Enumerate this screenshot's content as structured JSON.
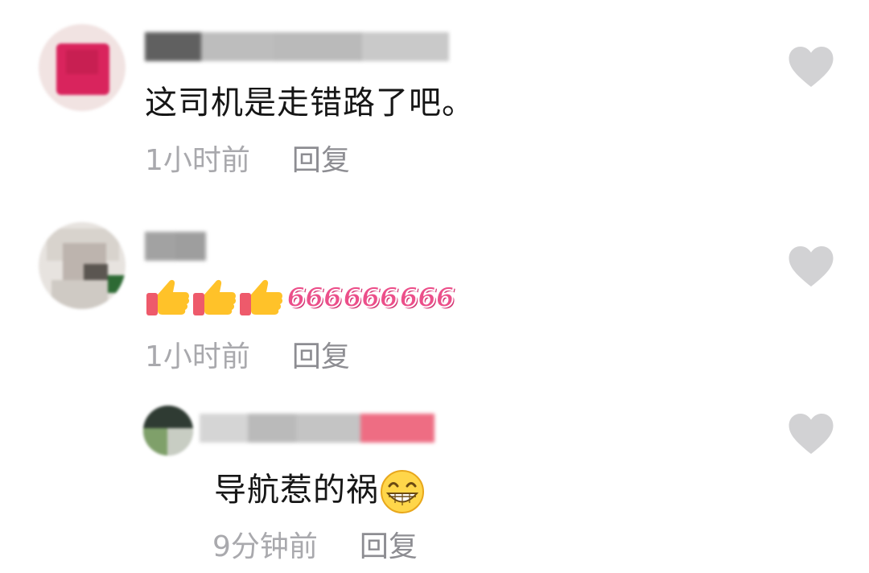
{
  "comments": [
    {
      "text": "这司机是走错路了吧。",
      "time": "1小时前",
      "reply_label": "回复"
    },
    {
      "emoji": [
        "thumbs-up-icon",
        "thumbs-up-icon",
        "thumbs-up-icon"
      ],
      "sticker": [
        "666",
        "666",
        "666"
      ],
      "time": "1小时前",
      "reply_label": "回复"
    },
    {
      "text": "导航惹的祸",
      "emoji": "grinning-face-icon",
      "time": "9分钟前",
      "reply_label": "回复"
    }
  ],
  "colors": {
    "text": "#161616",
    "meta": "#a9a9ad",
    "heart": "#d2d2d4",
    "sticker": "#ec4f8a"
  }
}
